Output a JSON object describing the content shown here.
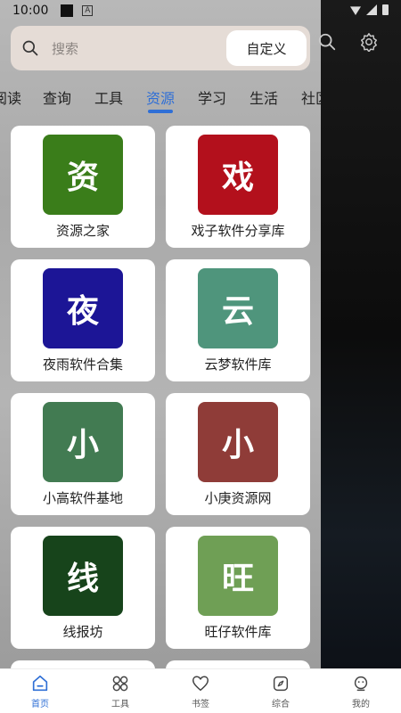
{
  "status": {
    "time": "10:00",
    "a_glyph": "A"
  },
  "search": {
    "placeholder": "搜索",
    "custom_button": "自定义"
  },
  "tabs": [
    {
      "label": "阅读"
    },
    {
      "label": "查询"
    },
    {
      "label": "工具"
    },
    {
      "label": "资源",
      "active": true
    },
    {
      "label": "学习"
    },
    {
      "label": "生活"
    },
    {
      "label": "社区"
    }
  ],
  "cards": [
    {
      "label": "资源之家",
      "icon_char": "资",
      "icon_color": "#3a7d1a"
    },
    {
      "label": "戏子软件分享库",
      "icon_char": "戏",
      "icon_color": "#b3101c"
    },
    {
      "label": "夜雨软件合集",
      "icon_char": "夜",
      "icon_color": "#1c1596"
    },
    {
      "label": "云梦软件库",
      "icon_char": "云",
      "icon_color": "#4f957c"
    },
    {
      "label": "小高软件基地",
      "icon_char": "小",
      "icon_color": "#427b52"
    },
    {
      "label": "小庚资源网",
      "icon_char": "小",
      "icon_color": "#8f3c38"
    },
    {
      "label": "线报坊",
      "icon_char": "线",
      "icon_color": "#17441b"
    },
    {
      "label": "旺仔软件库",
      "icon_char": "旺",
      "icon_color": "#6f9f55"
    }
  ],
  "bottom_nav": [
    {
      "label": "首页",
      "icon": "home-icon",
      "active": true
    },
    {
      "label": "工具",
      "icon": "tools-icon"
    },
    {
      "label": "书签",
      "icon": "bookmark-icon"
    },
    {
      "label": "综合",
      "icon": "compass-icon"
    },
    {
      "label": "我的",
      "icon": "profile-icon"
    }
  ],
  "colors": {
    "accent": "#2f6fd6",
    "search_bg": "#e5dcd6"
  }
}
